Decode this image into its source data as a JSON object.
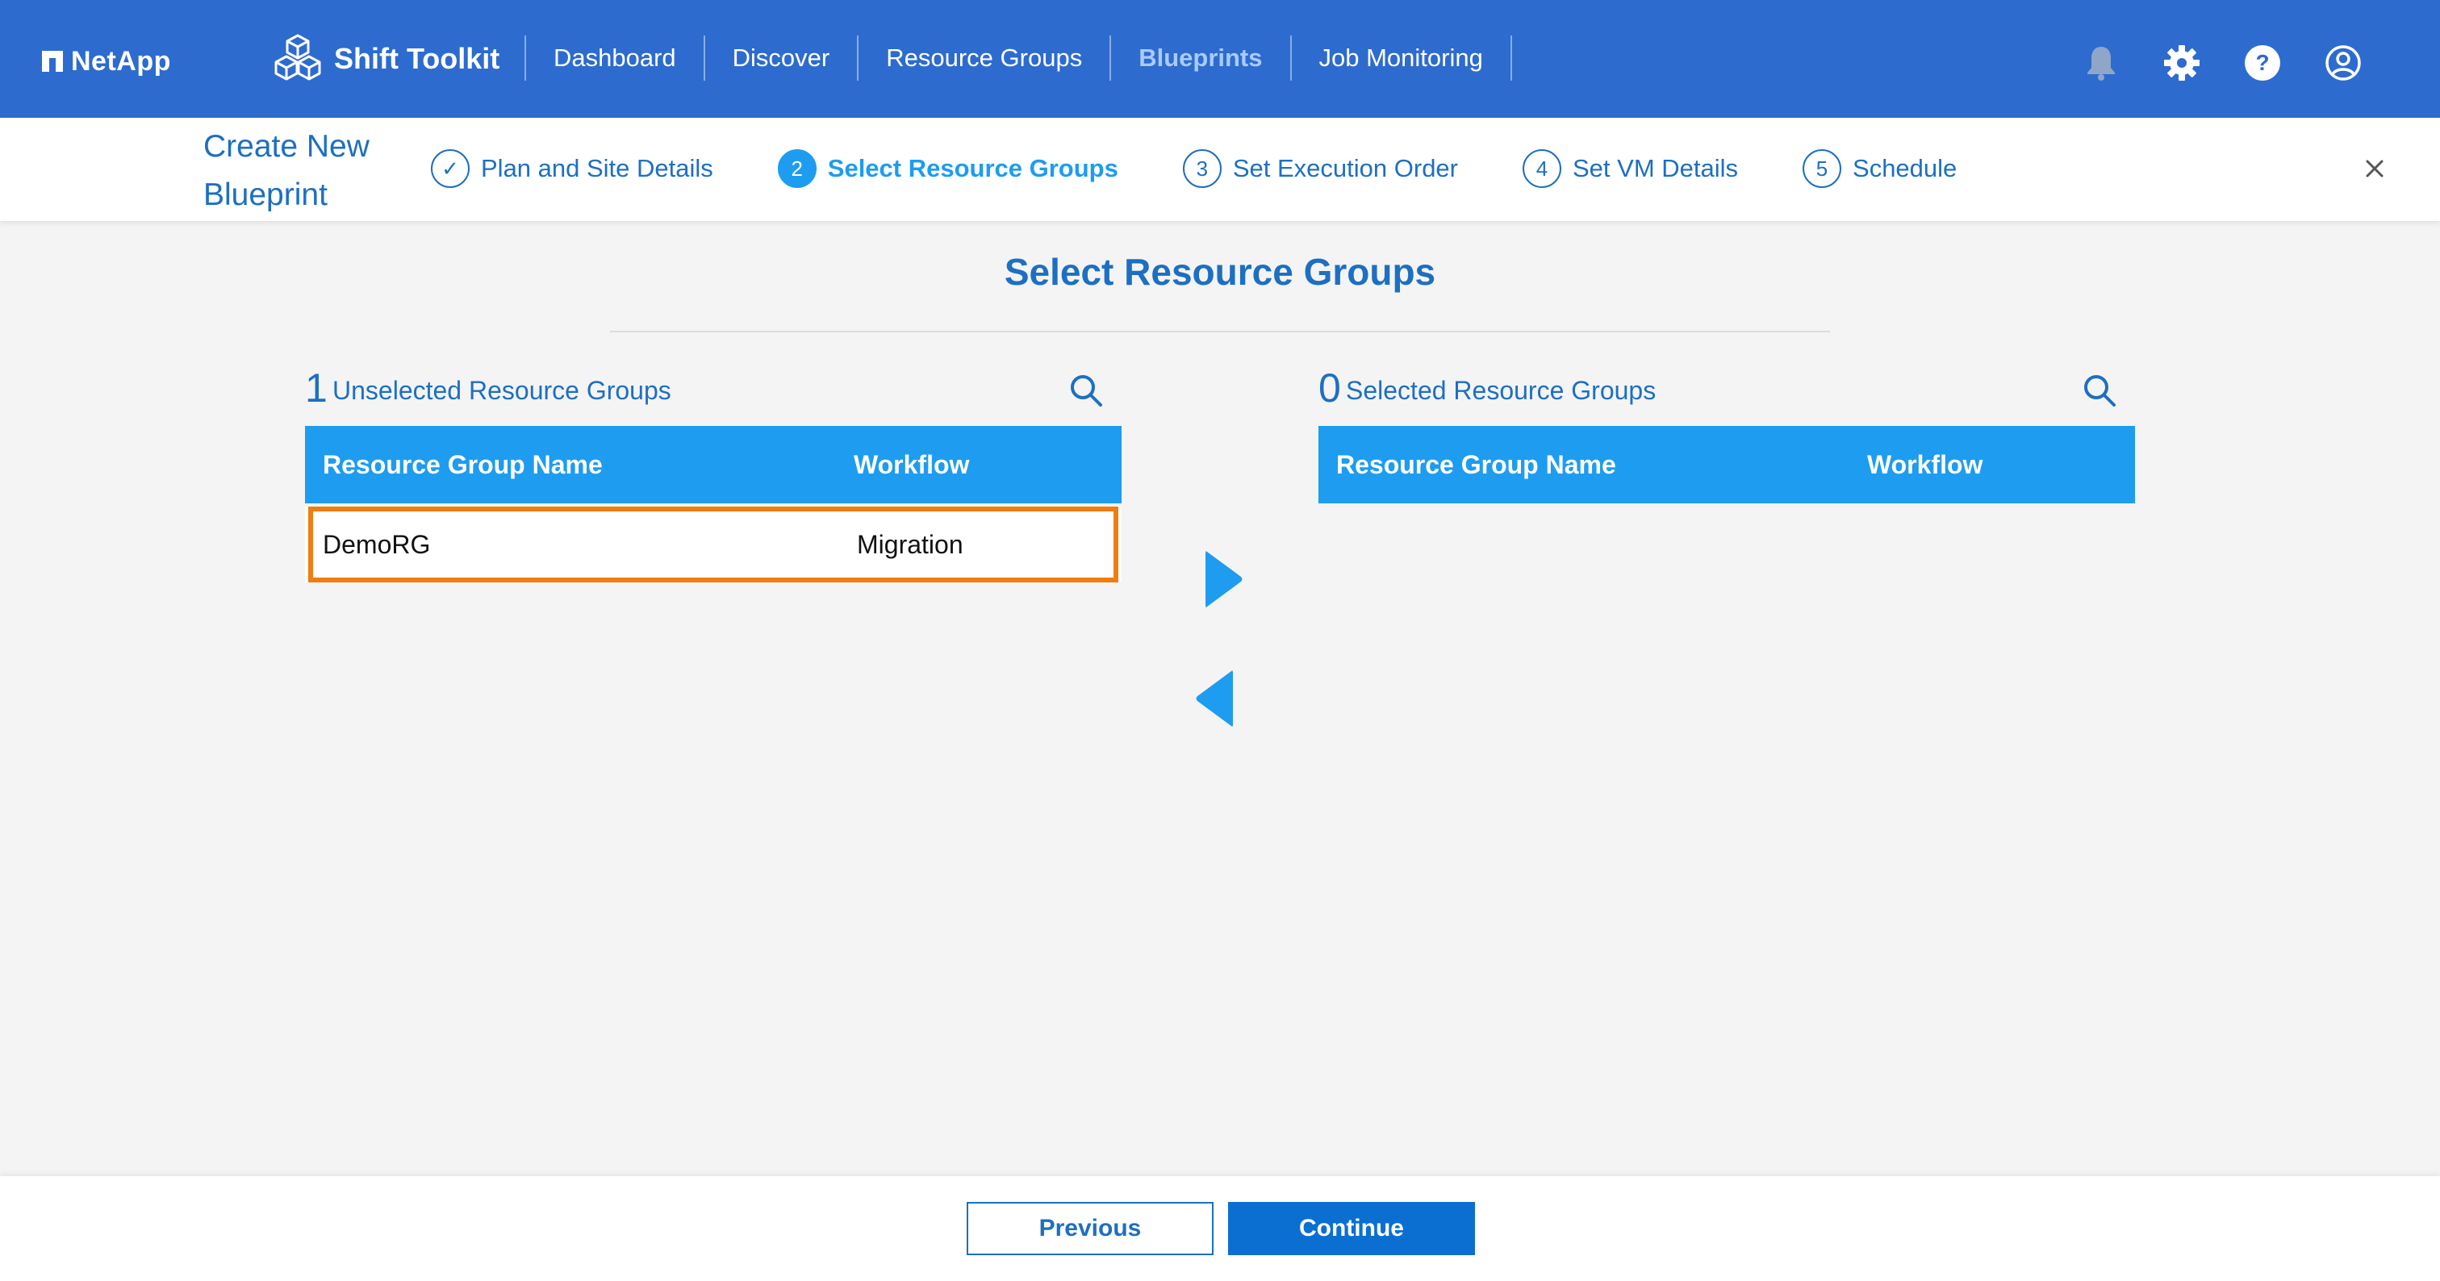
{
  "topnav": {
    "brand": "NetApp",
    "product": "Shift Toolkit",
    "links": [
      {
        "label": "Dashboard",
        "active": false
      },
      {
        "label": "Discover",
        "active": false
      },
      {
        "label": "Resource Groups",
        "active": false
      },
      {
        "label": "Blueprints",
        "active": true
      },
      {
        "label": "Job Monitoring",
        "active": false
      }
    ],
    "icons": [
      "bell-icon",
      "gear-icon",
      "help-icon",
      "user-icon"
    ]
  },
  "wizard": {
    "title": "Create New Blueprint",
    "steps": [
      {
        "marker": "✓",
        "label": "Plan and Site Details",
        "state": "done"
      },
      {
        "marker": "2",
        "label": "Select Resource Groups",
        "state": "active"
      },
      {
        "marker": "3",
        "label": "Set Execution Order",
        "state": "pending"
      },
      {
        "marker": "4",
        "label": "Set VM Details",
        "state": "pending"
      },
      {
        "marker": "5",
        "label": "Schedule",
        "state": "pending"
      }
    ]
  },
  "main": {
    "title": "Select Resource Groups",
    "unselected": {
      "count": "1",
      "caption": "Unselected Resource Groups",
      "columns": {
        "name": "Resource Group Name",
        "workflow": "Workflow"
      },
      "rows": [
        {
          "name": "DemoRG",
          "workflow": "Migration"
        }
      ]
    },
    "selected": {
      "count": "0",
      "caption": "Selected Resource Groups",
      "columns": {
        "name": "Resource Group Name",
        "workflow": "Workflow"
      },
      "rows": []
    }
  },
  "footer": {
    "previous_label": "Previous",
    "continue_label": "Continue"
  },
  "colors": {
    "nav_bg": "#2d6bcf",
    "accent": "#1e9cf0",
    "primary_text": "#1d6fc2",
    "highlight": "#f07d10",
    "primary_button": "#0b6fd2"
  }
}
